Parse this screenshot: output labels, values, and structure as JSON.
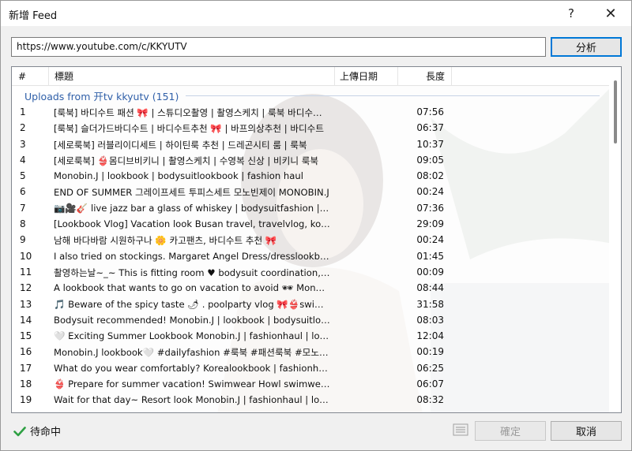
{
  "window": {
    "title": "新增 Feed",
    "help_label": "?",
    "close_label": "✕"
  },
  "url_input": {
    "value": "https://www.youtube.com/c/KKYUTV"
  },
  "analyze_button": {
    "label": "分析"
  },
  "table": {
    "columns": {
      "num": "#",
      "title": "標題",
      "date": "上傳日期",
      "length": "長度"
    },
    "group_label": "Uploads from 开tv kkyutv (151)",
    "rows": [
      {
        "num": "1",
        "title": "[룩북] 바디수트 패션 🎀 | 스튜디오촬영 | 촬영스케치 | 룩북 바디수트 룩북",
        "date": "",
        "length": "07:56"
      },
      {
        "num": "2",
        "title": "[룩북] 슬더가드바디수트 | 바디수트추천 🎀 | 바프의상추천 | 바디수트",
        "date": "",
        "length": "06:37"
      },
      {
        "num": "3",
        "title": "[세로룩북] 러블리이디세트 | 하이틴룩 추천 | 드레곤시티 룸 | 룩북",
        "date": "",
        "length": "10:37"
      },
      {
        "num": "4",
        "title": "[세로룩북] 👙몸디브비키니 | 촬영스케치 | 수영복 신상 | 비키니 룩북",
        "date": "",
        "length": "09:05"
      },
      {
        "num": "5",
        "title": "Monobin.J | lookbook | bodysuitlookbook | fashion haul",
        "date": "",
        "length": "08:02"
      },
      {
        "num": "6",
        "title": "END OF SUMMER 그레이프세트 투피스세트 모노빈제이 MONOBIN.J",
        "date": "",
        "length": "00:24"
      },
      {
        "num": "7",
        "title": "📷🎥🎸 live jazz bar a glass of whiskey | bodysuitfashion | dress lookbook",
        "date": "",
        "length": "07:36"
      },
      {
        "num": "8",
        "title": "[Lookbook Vlog] Vacation look Busan travel, travelvlog, korea lookbook",
        "date": "",
        "length": "29:09"
      },
      {
        "num": "9",
        "title": "남해 바다바람 시원하구나 🌼 카고팬츠, 바디수트 추천 🎀",
        "date": "",
        "length": "00:24"
      },
      {
        "num": "10",
        "title": "I also tried on stockings. Margaret Angel Dress/dresslookbook haul",
        "date": "",
        "length": "01:45"
      },
      {
        "num": "11",
        "title": "촬영하는날~_~ This is fitting room ♥ bodysuit coordination, lookbook",
        "date": "",
        "length": "00:09"
      },
      {
        "num": "12",
        "title": "A lookbook that wants to go on vacation to avoid 🕶 Monobin.J lookbook",
        "date": "",
        "length": "08:44"
      },
      {
        "num": "13",
        "title": "🎵 Beware of the spicy taste 🌶 . poolparty vlog 🎀👙swimsuit lookbook",
        "date": "",
        "length": "31:58"
      },
      {
        "num": "14",
        "title": "Bodysuit recommended! Monobin.J | lookbook | bodysuitlookbook haul",
        "date": "",
        "length": "08:03"
      },
      {
        "num": "15",
        "title": "🤍 Exciting Summer Lookbook Monobin.J | fashionhaul | lookbook haul",
        "date": "",
        "length": "12:04"
      },
      {
        "num": "16",
        "title": "Monobin.J lookbook🤍 #dailyfashion #룩북 #패션룩북 #모노빈제이",
        "date": "",
        "length": "00:19"
      },
      {
        "num": "17",
        "title": "What do you wear comfortably? Korealookbook | fashionhaul | lookbook",
        "date": "",
        "length": "06:25"
      },
      {
        "num": "18",
        "title": "👙 Prepare for summer vacation! Swimwear Howl swimwear lookbook",
        "date": "",
        "length": "06:07"
      },
      {
        "num": "19",
        "title": "Wait for that day~ Resort look Monobin.J | fashionhaul | lookbook",
        "date": "",
        "length": "08:32"
      }
    ]
  },
  "status": {
    "text": "待命中",
    "icon": "check-icon"
  },
  "ok_button": {
    "label": "確定"
  },
  "cancel_button": {
    "label": "取消"
  },
  "colors": {
    "accent": "#0078d7",
    "group_text": "#2f5fa8",
    "status_check": "#2ea043"
  }
}
